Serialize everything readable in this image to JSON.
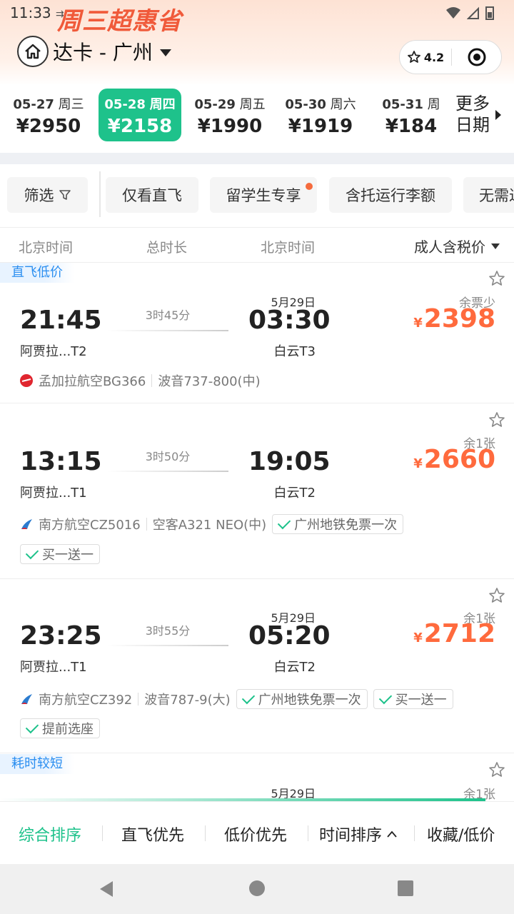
{
  "status": {
    "time": "11:33"
  },
  "promo": {
    "text": "周三超惠省"
  },
  "header": {
    "title": "达卡 - 广州",
    "rating": "4.2"
  },
  "dates": [
    {
      "date": "05-27",
      "weekday": "周三",
      "price": "¥2950",
      "selected": false
    },
    {
      "date": "05-28",
      "weekday": "周四",
      "price": "¥2158",
      "selected": true
    },
    {
      "date": "05-29",
      "weekday": "周五",
      "price": "¥1990",
      "selected": false
    },
    {
      "date": "05-30",
      "weekday": "周六",
      "price": "¥1919",
      "selected": false
    },
    {
      "date": "05-31",
      "weekday": "周",
      "price": "¥184",
      "selected": false
    }
  ],
  "more_dates": {
    "line1": "更多",
    "line2": "日期"
  },
  "filters": [
    "筛选",
    "仅看直飞",
    "留学生专享",
    "含托运行李额",
    "无需过"
  ],
  "columns": {
    "dep": "北京时间",
    "duration": "总时长",
    "arr": "北京时间",
    "price": "成人含税价"
  },
  "flights": [
    {
      "tag": "直飞低价",
      "dep_time": "21:45",
      "dep_airport": "阿贾拉...T2",
      "duration": "3时45分",
      "next_day": "5月29日",
      "arr_time": "03:30",
      "arr_airport": "白云T3",
      "seats": "余票少",
      "currency": "¥",
      "price": "2398",
      "airline": "孟加拉航空BG366",
      "aircraft": "波音737-800(中)",
      "badges": []
    },
    {
      "tag": "",
      "dep_time": "13:15",
      "dep_airport": "阿贾拉...T1",
      "duration": "3时50分",
      "next_day": "",
      "arr_time": "19:05",
      "arr_airport": "白云T2",
      "seats": "余1张",
      "currency": "¥",
      "price": "2660",
      "airline": "南方航空CZ5016",
      "aircraft": "空客A321 NEO(中)",
      "badges": [
        "广州地铁免票一次",
        "买一送一"
      ]
    },
    {
      "tag": "",
      "dep_time": "23:25",
      "dep_airport": "阿贾拉...T1",
      "duration": "3时55分",
      "next_day": "5月29日",
      "arr_time": "05:20",
      "arr_airport": "白云T2",
      "seats": "余1张",
      "currency": "¥",
      "price": "2712",
      "airline": "南方航空CZ392",
      "aircraft": "波音787-9(大)",
      "badges": [
        "广州地铁免票一次",
        "买一送一",
        "提前选座"
      ]
    },
    {
      "tag": "耗时较短",
      "next_day": "5月29日",
      "seats": "余1张"
    }
  ],
  "sort": [
    "综合排序",
    "直飞优先",
    "低价优先",
    "时间排序",
    "收藏/低价"
  ],
  "colors": {
    "accent": "#1ec28b",
    "price": "#ff6a3d",
    "tag": "#2a8ef0"
  }
}
